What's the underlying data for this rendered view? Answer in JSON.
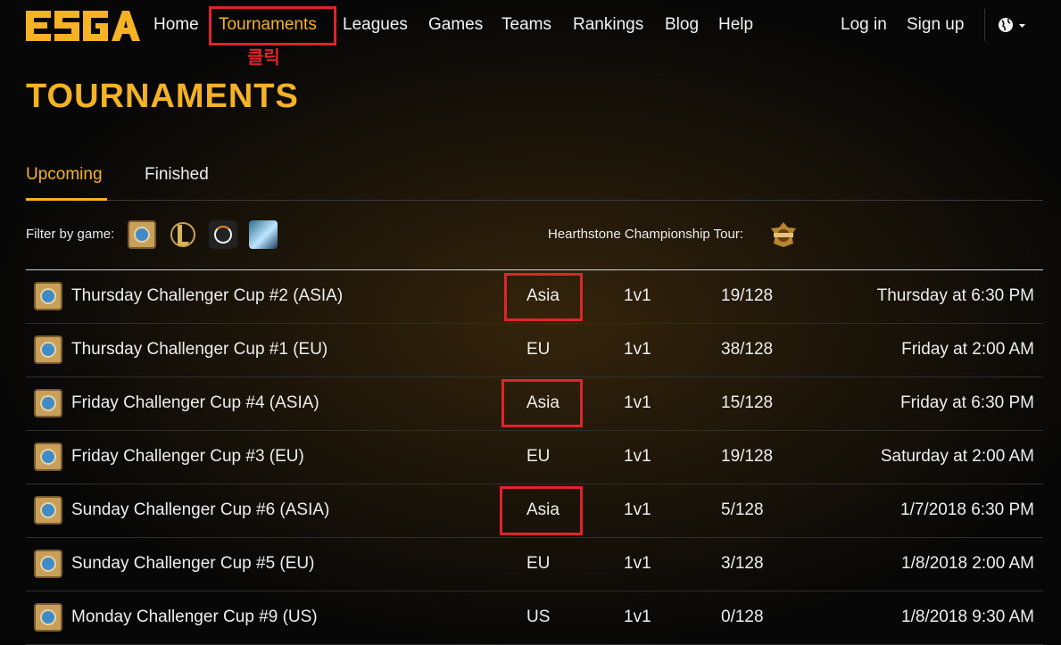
{
  "nav": {
    "logo_text": "ESGA",
    "items": [
      {
        "label": "Home"
      },
      {
        "label": "Tournaments"
      },
      {
        "label": "Leagues"
      },
      {
        "label": "Games"
      },
      {
        "label": "Teams"
      },
      {
        "label": "Rankings"
      },
      {
        "label": "Blog"
      },
      {
        "label": "Help"
      }
    ],
    "login_label": "Log in",
    "signup_label": "Sign up",
    "language_icon": "globe-icon"
  },
  "annotation": {
    "click_label": "클릭",
    "color": "#e0242b"
  },
  "page": {
    "title": "TOURNAMENTS",
    "accent_color": "#f5b224"
  },
  "tabs": [
    {
      "label": "Upcoming",
      "active": true
    },
    {
      "label": "Finished",
      "active": false
    }
  ],
  "filter": {
    "label": "Filter by game:",
    "games": [
      "hearthstone-icon",
      "league-of-legends-icon",
      "overwatch-icon",
      "dota2-icon"
    ],
    "hct_label": "Hearthstone Championship Tour:",
    "hct_icon": "hct-logo-icon"
  },
  "tournaments": [
    {
      "name": "Thursday Challenger Cup #2 (ASIA)",
      "region": "Asia",
      "mode": "1v1",
      "slots": "19/128",
      "time": "Thursday at 6:30 PM"
    },
    {
      "name": "Thursday Challenger Cup #1 (EU)",
      "region": "EU",
      "mode": "1v1",
      "slots": "38/128",
      "time": "Friday at 2:00 AM"
    },
    {
      "name": "Friday Challenger Cup #4 (ASIA)",
      "region": "Asia",
      "mode": "1v1",
      "slots": "15/128",
      "time": "Friday at 6:30 PM"
    },
    {
      "name": "Friday Challenger Cup #3 (EU)",
      "region": "EU",
      "mode": "1v1",
      "slots": "19/128",
      "time": "Saturday at 2:00 AM"
    },
    {
      "name": "Sunday Challenger Cup #6 (ASIA)",
      "region": "Asia",
      "mode": "1v1",
      "slots": "5/128",
      "time": "1/7/2018 6:30 PM"
    },
    {
      "name": "Sunday Challenger Cup #5 (EU)",
      "region": "EU",
      "mode": "1v1",
      "slots": "3/128",
      "time": "1/8/2018 2:00 AM"
    },
    {
      "name": "Monday Challenger Cup #9 (US)",
      "region": "US",
      "mode": "1v1",
      "slots": "0/128",
      "time": "1/8/2018 9:30 AM"
    }
  ]
}
